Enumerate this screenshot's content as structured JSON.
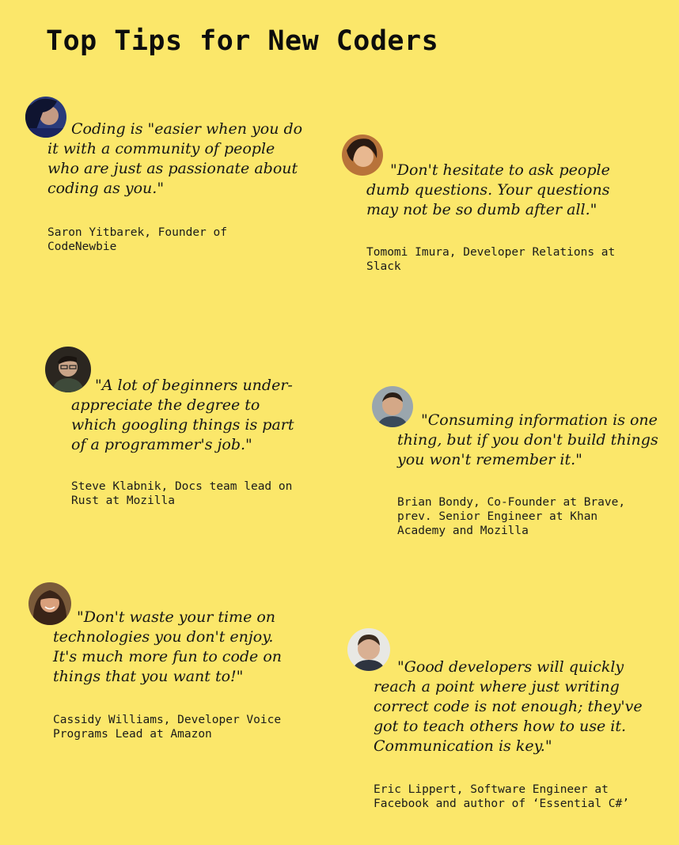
{
  "page": {
    "title": "Top Tips for New Coders",
    "background_color": "#fbe76a"
  },
  "tips": [
    {
      "quote": "Coding is \"easier when you do it with a community of people who are just as passionate about coding as you.\"",
      "author": "Saron Yitbarek, Founder of\nCodeNewbie",
      "avatar": "saron-yitbarek-photo"
    },
    {
      "quote": "\"Don't hesitate to ask people dumb questions. Your questions may not be so dumb after all.\"",
      "author": "Tomomi Imura, Developer Relations at\nSlack",
      "avatar": "tomomi-imura-photo"
    },
    {
      "quote": "\"A lot of beginners under-appreciate the degree to which googling things is part of a programmer's job.\"",
      "author": "Steve Klabnik, Docs team lead on\nRust at Mozilla",
      "avatar": "steve-klabnik-photo"
    },
    {
      "quote": "\"Consuming information is one thing, but if you don't build things you won't remember it.\"",
      "author": "Brian Bondy, Co-Founder at Brave,\nprev. Senior Engineer at Khan\nAcademy and Mozilla",
      "avatar": "brian-bondy-photo"
    },
    {
      "quote": "\"Don't waste your time on technologies you don't enjoy. It's much more fun to code on things that you want to!\"",
      "author": "Cassidy Williams, Developer Voice\nPrograms Lead at Amazon",
      "avatar": "cassidy-williams-photo"
    },
    {
      "quote": "\"Good developers will quickly reach a point where just writing correct code is not enough; they've got to teach others how to use it. Communication is key.\"",
      "author": "Eric Lippert, Software Engineer at\nFacebook and author of ‘Essential C#’",
      "avatar": "eric-lippert-photo"
    }
  ]
}
